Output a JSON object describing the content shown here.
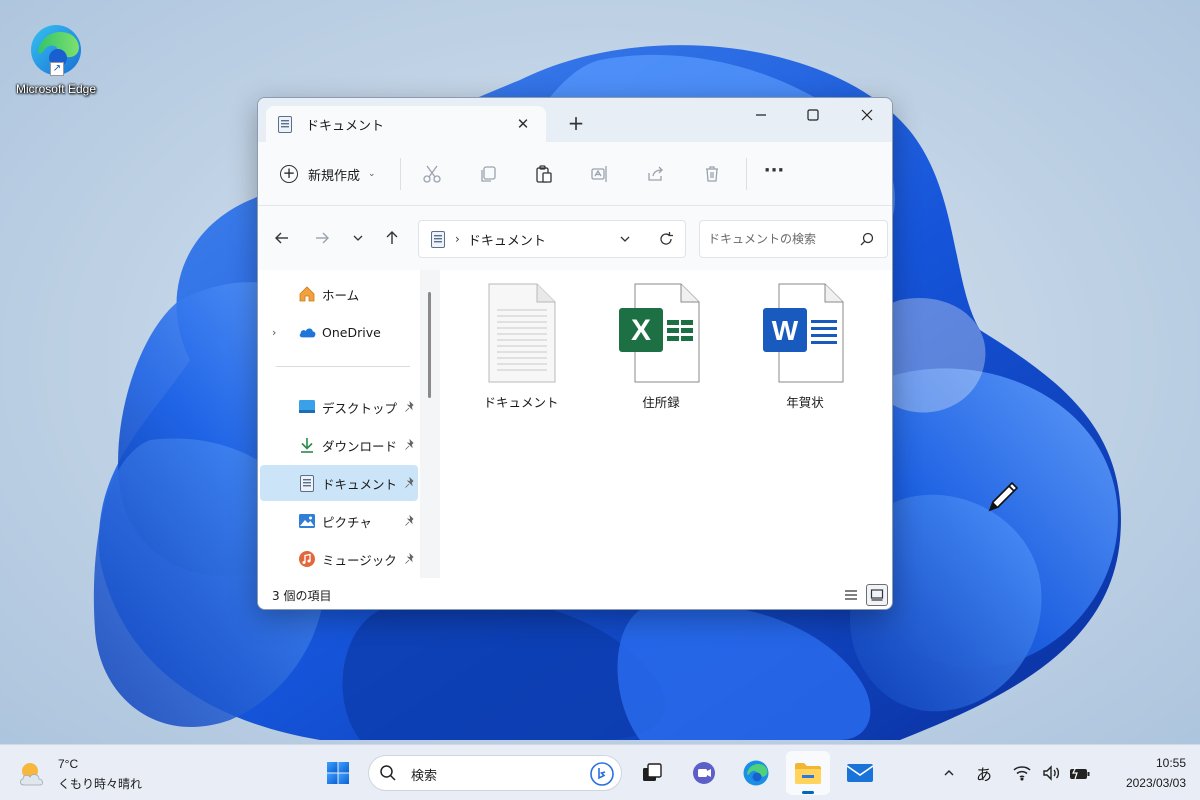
{
  "desktop": {
    "icons": [
      {
        "label": "Microsoft Edge"
      }
    ]
  },
  "window": {
    "tab_title": "ドキュメント",
    "tab_close_glyph": "✕",
    "new_tab_glyph": "+",
    "command_bar": {
      "new_label": "新規作成",
      "new_chevron": "⌄",
      "more_glyph": "···"
    },
    "address": {
      "separator": "›",
      "crumb": "ドキュメント"
    },
    "search": {
      "placeholder": "ドキュメントの検索"
    },
    "nav": {
      "items": [
        {
          "label": "ホーム",
          "icon": "home-icon"
        },
        {
          "label": "OneDrive",
          "icon": "onedrive-icon",
          "expander": "›"
        },
        {
          "label": "デスクトップ",
          "icon": "desktop-folder-icon",
          "pinned": true
        },
        {
          "label": "ダウンロード",
          "icon": "download-icon",
          "pinned": true
        },
        {
          "label": "ドキュメント",
          "icon": "documents-icon",
          "pinned": true,
          "selected": true
        },
        {
          "label": "ピクチャ",
          "icon": "pictures-icon",
          "pinned": true
        },
        {
          "label": "ミュージック",
          "icon": "music-icon",
          "pinned": true
        }
      ]
    },
    "files": [
      {
        "name": "ドキュメント",
        "type": "text-document"
      },
      {
        "name": "住所録",
        "type": "excel"
      },
      {
        "name": "年賀状",
        "type": "word"
      }
    ],
    "file_badges": {
      "excel": "X",
      "word": "W"
    },
    "status": {
      "item_count": "3 個の項目"
    }
  },
  "taskbar": {
    "weather": {
      "temp": "7°C",
      "condition": "くもり時々晴れ"
    },
    "search_placeholder": "検索",
    "ime": "あ",
    "clock": {
      "time": "10:55",
      "date": "2023/03/03"
    }
  },
  "colors": {
    "accent": "#0067c0",
    "selection": "#cce4f7",
    "excel_green": "#1d7044",
    "word_blue": "#185abd"
  }
}
